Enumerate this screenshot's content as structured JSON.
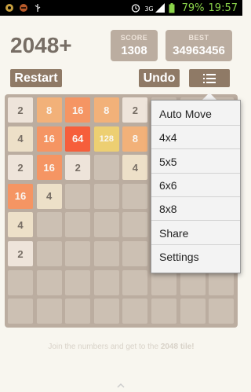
{
  "statusbar": {
    "signal_label": "3G",
    "battery_percent": "79%",
    "time": "19:57"
  },
  "game": {
    "title": "2048+",
    "score_label": "SCORE",
    "score_value": "1308",
    "best_label": "BEST",
    "best_value": "34963456"
  },
  "buttons": {
    "restart": "Restart",
    "undo": "Undo"
  },
  "board": {
    "rows": [
      [
        "2",
        "8",
        "16",
        "8",
        "2",
        "",
        "",
        ""
      ],
      [
        "4",
        "16",
        "64",
        "128",
        "8",
        "",
        "2",
        ""
      ],
      [
        "2",
        "16",
        "2",
        "",
        "4",
        "",
        "",
        ""
      ],
      [
        "16",
        "4",
        "",
        "",
        "",
        "",
        "",
        ""
      ],
      [
        "4",
        "",
        "",
        "",
        "",
        "",
        "",
        ""
      ],
      [
        "2",
        "",
        "",
        "",
        "",
        "",
        "",
        ""
      ],
      [
        "",
        "",
        "",
        "",
        "",
        "",
        "",
        ""
      ],
      [
        "",
        "",
        "",
        "",
        "",
        "",
        "",
        ""
      ]
    ]
  },
  "menu": {
    "items": [
      "Auto Move",
      "4x4",
      "5x5",
      "6x6",
      "8x8",
      "Share",
      "Settings"
    ]
  },
  "footer": {
    "text": "Join the numbers and get to the ",
    "highlight": "2048 tile!"
  }
}
